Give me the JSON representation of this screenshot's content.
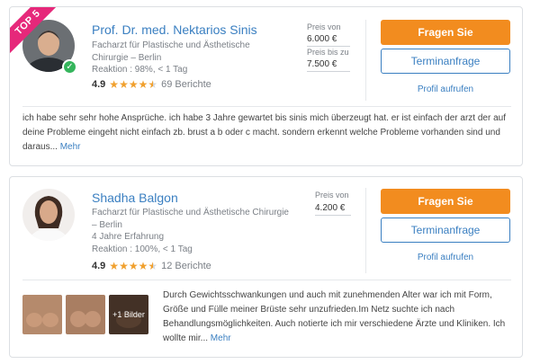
{
  "doctors": [
    {
      "ribbon": "TOP 5",
      "name": "Prof. Dr. med. Nektarios Sinis",
      "specialty": "Facharzt für Plastische und Ästhetische Chirurgie – Berlin",
      "reaction": "Reaktion : 98%, < 1 Tag",
      "rating": "4.9",
      "stars": 4.5,
      "reviews": "69 Berichte",
      "price_from_label": "Preis von",
      "price_from": "6.000 €",
      "price_to_label": "Preis bis zu",
      "price_to": "7.500 €",
      "ask_button": "Fragen Sie",
      "appointment_button": "Terminanfrage",
      "profile_link": "Profil aufrufen",
      "review_text": "ich habe sehr sehr hohe Ansprüche. ich habe 3 Jahre gewartet bis sinis mich überzeugt hat. er ist einfach der arzt der auf deine Probleme eingeht nicht einfach zb. brust a b oder c macht. sondern erkennt welche Probleme vorhanden sind und daraus...",
      "more_link": "Mehr"
    },
    {
      "name": "Shadha Balgon",
      "specialty": "Facharzt für Plastische und Ästhetische Chirurgie – Berlin",
      "experience": "4 Jahre Erfahrung",
      "reaction": "Reaktion : 100%, < 1 Tag",
      "rating": "4.9",
      "stars": 4.5,
      "reviews": "12 Berichte",
      "price_label": "Preis von",
      "price": "4.200 €",
      "ask_button": "Fragen Sie",
      "appointment_button": "Terminanfrage",
      "profile_link": "Profil aufrufen",
      "images_more": "+1 Bilder",
      "review_text": "Durch Gewichtsschwankungen und auch mit zunehmenden Alter war ich mit Form, Größe und Fülle meiner Brüste sehr unzufrieden.Im Netz suchte ich nach Behandlungsmöglichkeiten. Auch notierte ich mir verschiedene Ärzte und Kliniken. Ich wollte mir...",
      "more_link": "Mehr"
    }
  ],
  "colors": {
    "accent_orange": "#f28c1f",
    "link_blue": "#3a7fc1",
    "ribbon_pink": "#e6287a",
    "verified_green": "#35b55c",
    "star": "#f0a02e"
  }
}
